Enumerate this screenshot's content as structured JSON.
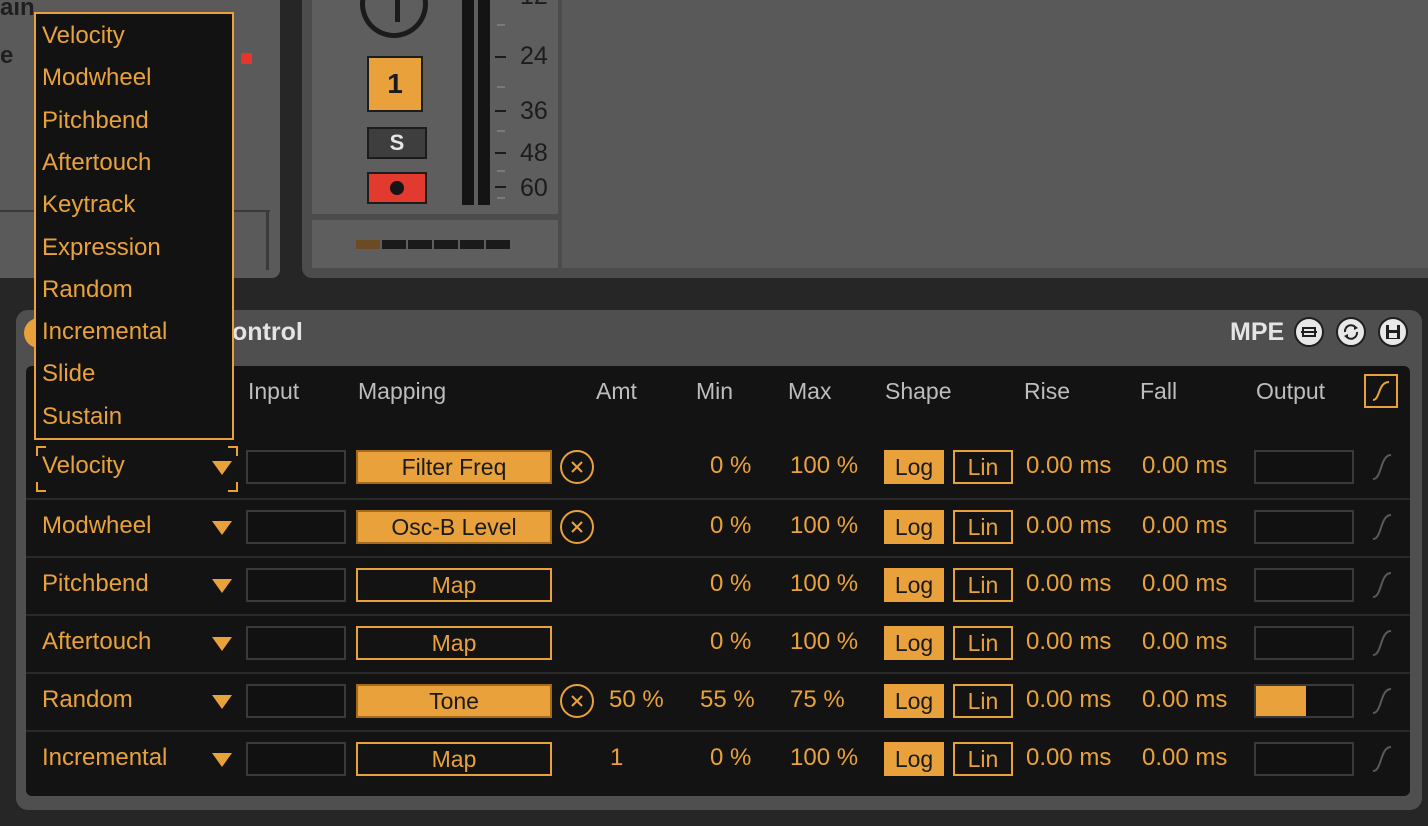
{
  "left_panel": {
    "partial_label_1": "ain",
    "partial_label_2": "e"
  },
  "track": {
    "number_label": "1",
    "solo_label": "S",
    "meter_scale": [
      "12",
      "24",
      "36",
      "48",
      "60"
    ]
  },
  "device": {
    "title": "ontrol",
    "mpe_label": "MPE",
    "columns": {
      "input": "Input",
      "mapping": "Mapping",
      "amt": "Amt",
      "min": "Min",
      "max": "Max",
      "shape": "Shape",
      "rise": "Rise",
      "fall": "Fall",
      "output": "Output"
    },
    "rows": [
      {
        "source": "Velocity",
        "mapping": "Filter Freq",
        "mapped": true,
        "amt": "",
        "min": "0 %",
        "max": "100 %",
        "shape_log": "Log",
        "shape_lin": "Lin",
        "rise": "0.00 ms",
        "fall": "0.00 ms",
        "output_level": 0
      },
      {
        "source": "Modwheel",
        "mapping": "Osc-B Level",
        "mapped": true,
        "amt": "",
        "min": "0 %",
        "max": "100 %",
        "shape_log": "Log",
        "shape_lin": "Lin",
        "rise": "0.00 ms",
        "fall": "0.00 ms",
        "output_level": 0
      },
      {
        "source": "Pitchbend",
        "mapping": "Map",
        "mapped": false,
        "amt": "",
        "min": "0 %",
        "max": "100 %",
        "shape_log": "Log",
        "shape_lin": "Lin",
        "rise": "0.00 ms",
        "fall": "0.00 ms",
        "output_level": 0
      },
      {
        "source": "Aftertouch",
        "mapping": "Map",
        "mapped": false,
        "amt": "",
        "min": "0 %",
        "max": "100 %",
        "shape_log": "Log",
        "shape_lin": "Lin",
        "rise": "0.00 ms",
        "fall": "0.00 ms",
        "output_level": 0
      },
      {
        "source": "Random",
        "mapping": "Tone",
        "mapped": true,
        "amt": "50 %",
        "min": "55 %",
        "max": "75 %",
        "shape_log": "Log",
        "shape_lin": "Lin",
        "rise": "0.00 ms",
        "fall": "0.00 ms",
        "output_level": 0.52
      },
      {
        "source": "Incremental",
        "mapping": "Map",
        "mapped": false,
        "amt": "1",
        "min": "0 %",
        "max": "100 %",
        "shape_log": "Log",
        "shape_lin": "Lin",
        "rise": "0.00 ms",
        "fall": "0.00 ms",
        "output_level": 0
      }
    ]
  },
  "dropdown": {
    "options": [
      "Velocity",
      "Modwheel",
      "Pitchbend",
      "Aftertouch",
      "Keytrack",
      "Expression",
      "Random",
      "Incremental",
      "Slide",
      "Sustain"
    ]
  },
  "colors": {
    "accent": "#e9a23b",
    "record": "#e23a2e",
    "background": "#131313"
  }
}
